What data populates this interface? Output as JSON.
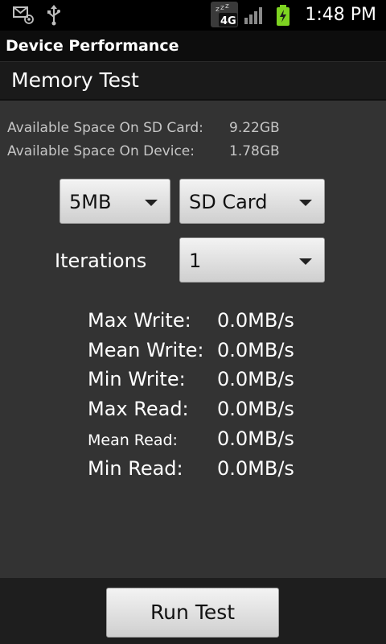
{
  "status_bar": {
    "time": "1:48 PM",
    "icons": [
      "mail-icon",
      "usb-icon",
      "4g-network-icon",
      "signal-icon",
      "battery-charging-icon"
    ],
    "network_label": "4G"
  },
  "app": {
    "title": "Device Performance"
  },
  "section": {
    "title": "Memory Test"
  },
  "info": {
    "sd_label": "Available Space On SD Card:",
    "sd_value": "9.22GB",
    "device_label": "Available Space On Device:",
    "device_value": "1.78GB"
  },
  "controls": {
    "size_selected": "5MB",
    "location_selected": "SD Card",
    "iterations_label": "Iterations",
    "iterations_selected": "1"
  },
  "results": [
    {
      "label": "Max Write:",
      "value": "0.0MB/s"
    },
    {
      "label": "Mean Write:",
      "value": "0.0MB/s"
    },
    {
      "label": "Min Write:",
      "value": "0.0MB/s"
    },
    {
      "label": "Max Read:",
      "value": "0.0MB/s"
    },
    {
      "label": "Mean Read:",
      "value": "0.0MB/s"
    },
    {
      "label": "Min Read:",
      "value": "0.0MB/s"
    }
  ],
  "actions": {
    "run_label": "Run Test"
  },
  "colors": {
    "background": "#333333",
    "status_bar": "#000000",
    "battery_green": "#7ed321",
    "spinner_face": "#e6e6e6"
  }
}
